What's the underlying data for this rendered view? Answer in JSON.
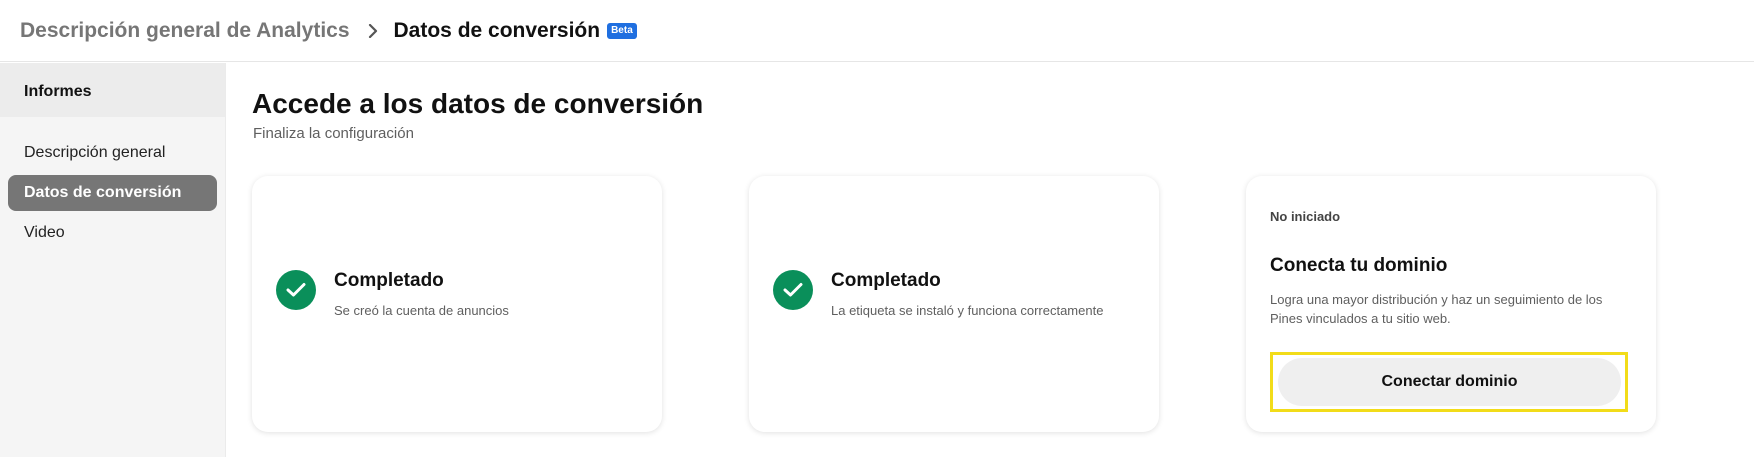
{
  "breadcrumb": {
    "root": "Descripción general de Analytics",
    "current": "Datos de conversión",
    "badge": "Beta"
  },
  "sidebar": {
    "header": "Informes",
    "items": [
      {
        "label": "Descripción general",
        "active": false
      },
      {
        "label": "Datos de conversión",
        "active": true
      },
      {
        "label": "Video",
        "active": false
      }
    ]
  },
  "main": {
    "title": "Accede a los datos de conversión",
    "subtitle": "Finaliza la configuración",
    "cards": [
      {
        "status": "Completado",
        "description": "Se creó la cuenta de anuncios",
        "icon": "check-circle-icon"
      },
      {
        "status": "Completado",
        "description": "La etiqueta se instaló y funciona correctamente",
        "icon": "check-circle-icon"
      },
      {
        "status": "No iniciado",
        "title": "Conecta tu dominio",
        "description": "Logra una mayor distribución y haz un seguimiento de los Pines vinculados a tu sitio web.",
        "button": "Conectar dominio"
      }
    ]
  },
  "colors": {
    "accent_green": "#0a8f5a",
    "active_nav": "#767676",
    "beta_badge": "#1f6fe0",
    "highlight": "#f2dc19"
  }
}
